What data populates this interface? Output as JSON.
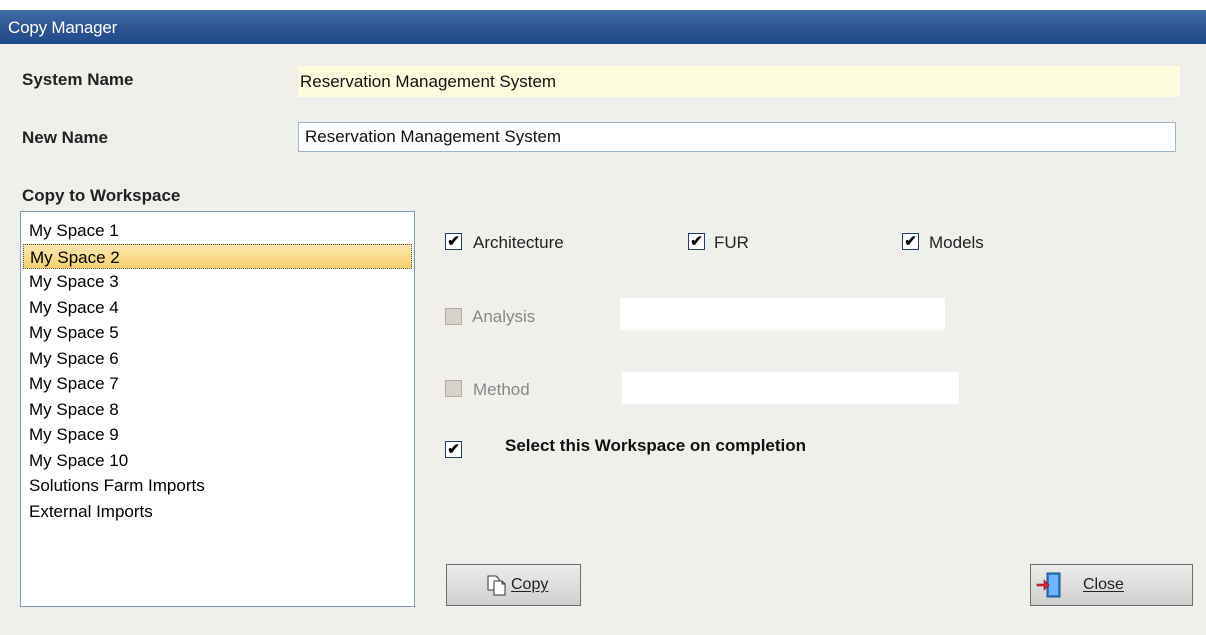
{
  "window": {
    "title": "Copy Manager"
  },
  "form": {
    "system_name_label": "System Name",
    "system_name_value": "Reservation Management System",
    "new_name_label": "New Name",
    "new_name_value": "Reservation Management System",
    "copy_to_label": "Copy to Workspace"
  },
  "workspaces": {
    "items": [
      "My Space 1",
      "My Space 2",
      "My Space 3",
      "My Space 4",
      "My Space 5",
      "My Space 6",
      "My Space 7",
      "My Space 8",
      "My Space 9",
      "My Space 10",
      "Solutions  Farm Imports",
      "External Imports"
    ],
    "selected": "My Space 2"
  },
  "options": {
    "architecture": {
      "label": "Architecture",
      "checked": true
    },
    "fur": {
      "label": "FUR",
      "checked": true
    },
    "models": {
      "label": "Models",
      "checked": true
    },
    "analysis": {
      "label": "Analysis",
      "checked": false,
      "disabled": true
    },
    "method": {
      "label": "Method",
      "checked": false,
      "disabled": true
    },
    "select_on_completion": {
      "label": "Select this Workspace on completion",
      "checked": true
    }
  },
  "buttons": {
    "copy_label": "Copy",
    "close_label": "Close"
  },
  "icons": {
    "copy": "copy-documents-icon",
    "close": "exit-door-icon"
  }
}
